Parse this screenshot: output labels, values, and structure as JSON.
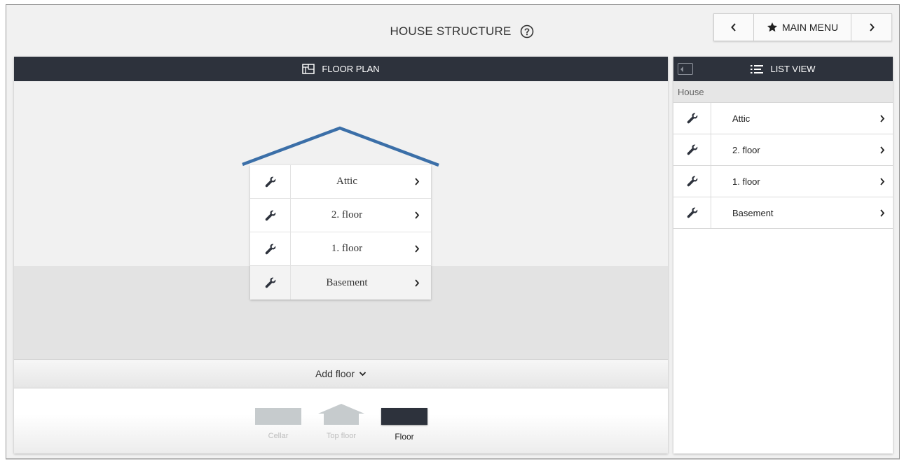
{
  "header": {
    "title": "HOUSE STRUCTURE",
    "nav": {
      "prev_icon": "chevron-left-icon",
      "main_menu_label": "MAIN MENU",
      "next_icon": "chevron-right-icon"
    }
  },
  "floor_plan": {
    "header_label": "FLOOR PLAN",
    "floors": [
      {
        "label": "Attic"
      },
      {
        "label": "2. floor"
      },
      {
        "label": "1. floor"
      },
      {
        "label": "Basement"
      }
    ],
    "add_floor_label": "Add floor",
    "floor_types": [
      {
        "label": "Cellar"
      },
      {
        "label": "Top floor"
      },
      {
        "label": "Floor"
      }
    ]
  },
  "list_view": {
    "header_label": "LIST VIEW",
    "section_label": "House",
    "items": [
      {
        "label": "Attic"
      },
      {
        "label": "2. floor"
      },
      {
        "label": "1. floor"
      },
      {
        "label": "Basement"
      }
    ]
  },
  "colors": {
    "header_bg": "#2d323c",
    "roof": "#3b6fa8",
    "canvas_bg": "#f1f1f1",
    "cellar_swatch": "#c6cbcd"
  }
}
